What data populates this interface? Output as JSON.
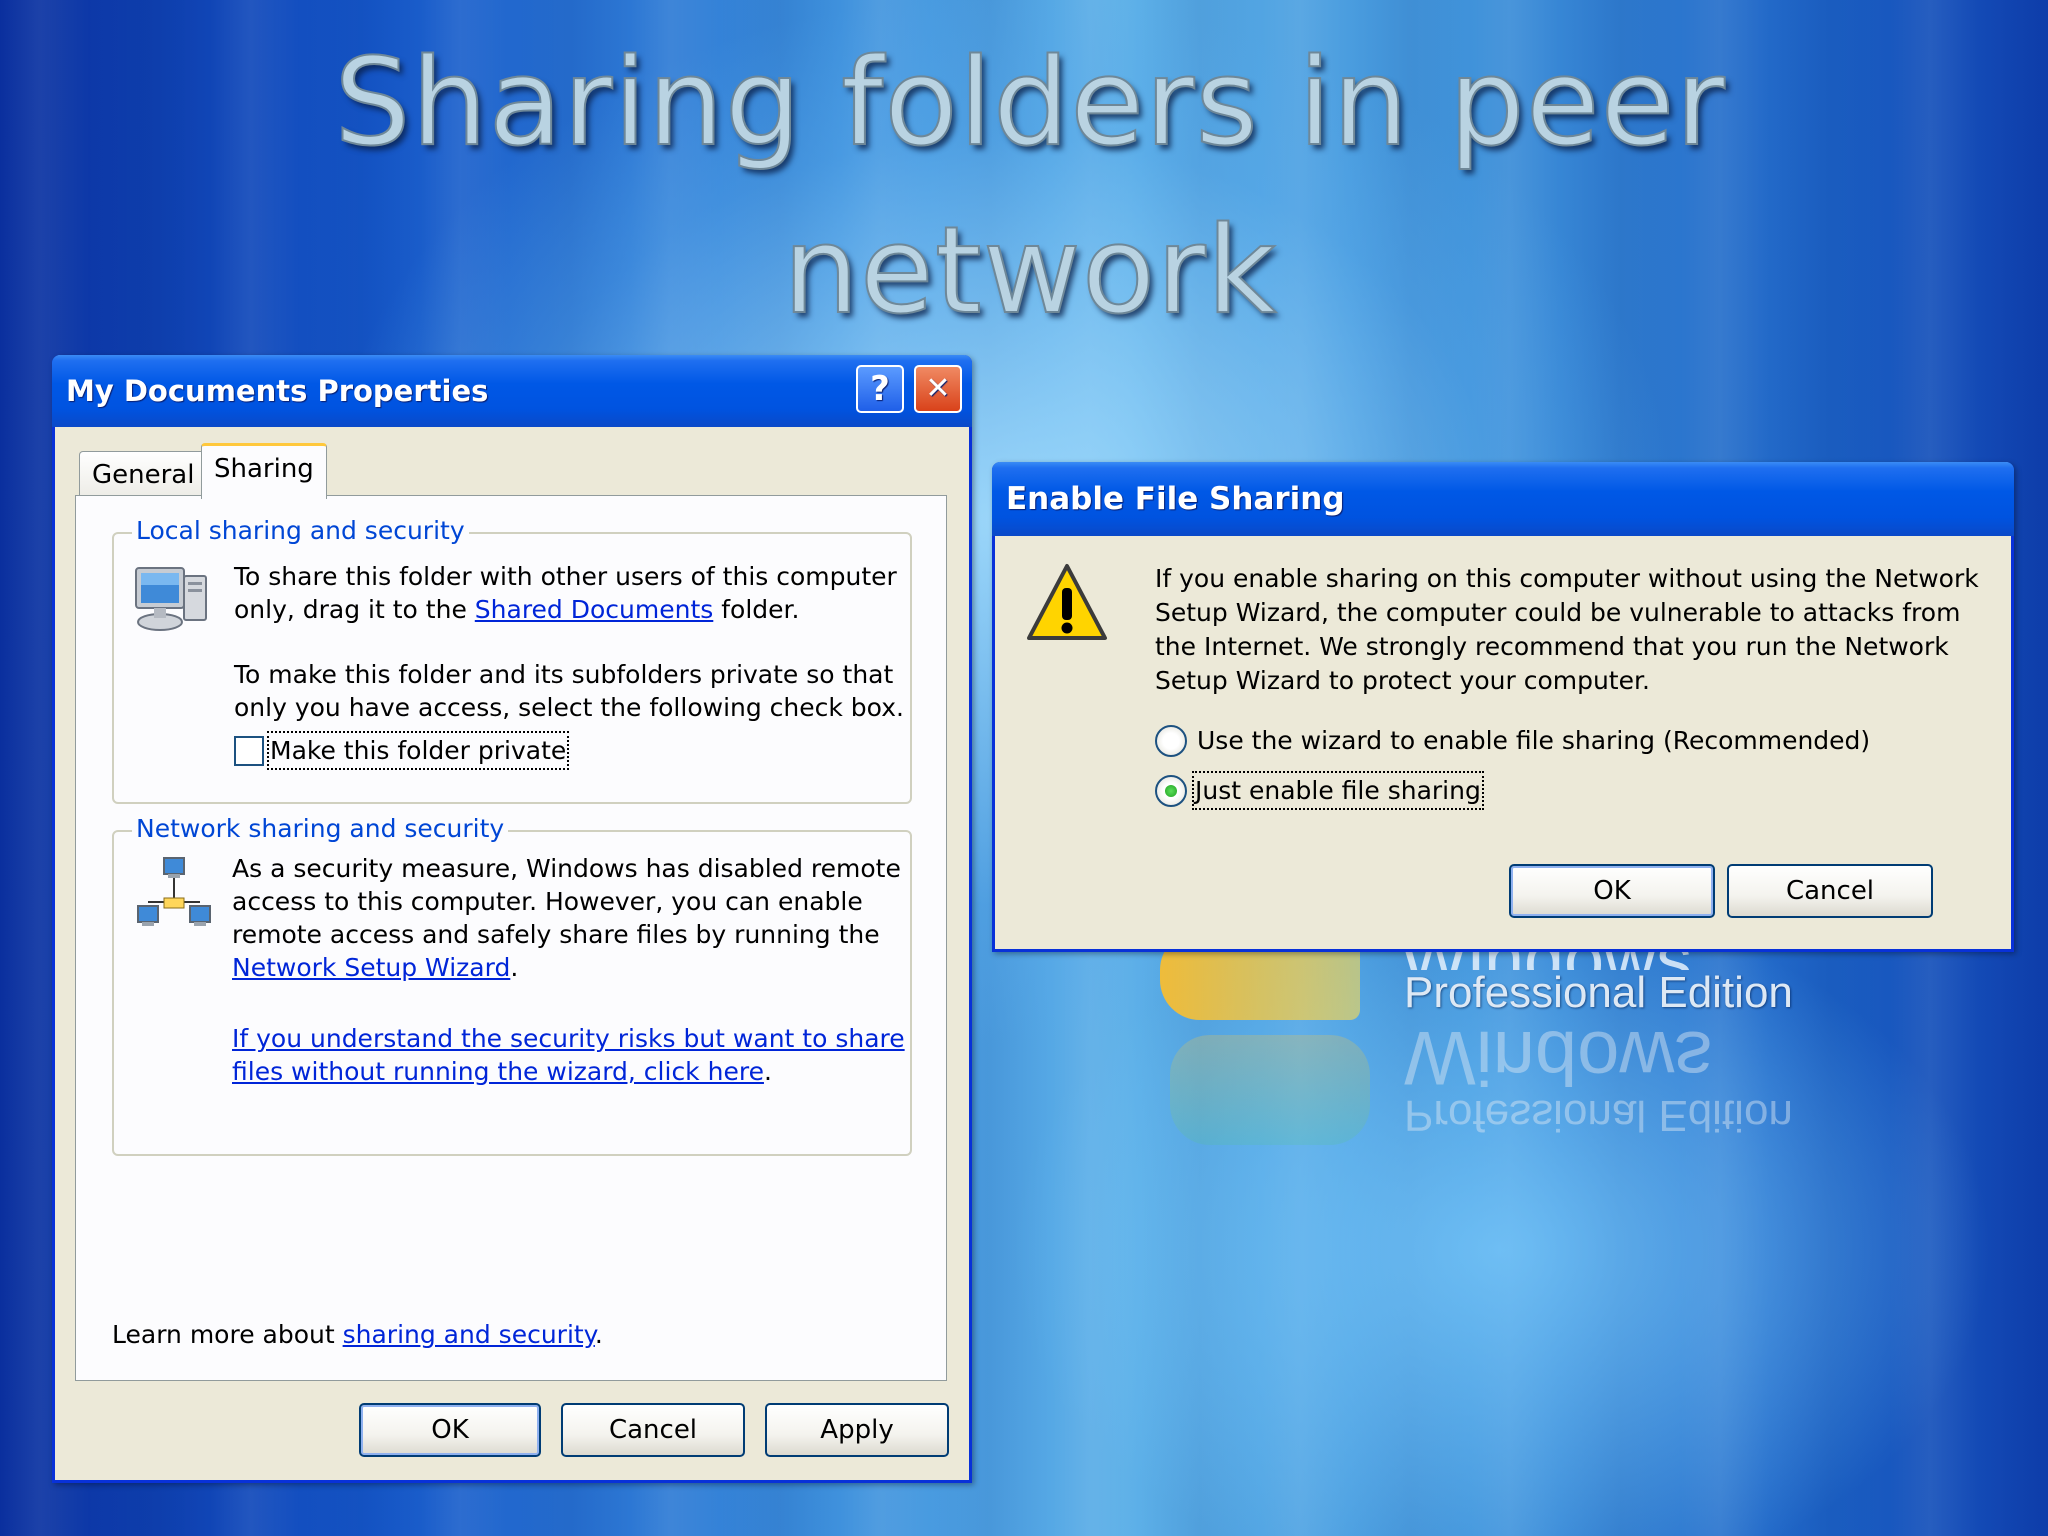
{
  "slide": {
    "title": "Sharing folders in peer network",
    "logo_word": "Windows",
    "logo_edition": "Professional Edition"
  },
  "props_window": {
    "title": "My Documents Properties",
    "help_label": "?",
    "close_label": "✕",
    "tabs": [
      {
        "label": "General",
        "active": false
      },
      {
        "label": "Sharing",
        "active": true
      }
    ],
    "local_group": {
      "legend": "Local sharing and security",
      "line1": "To share this folder with other users of this computer",
      "line2_prefix": "only, drag it to the ",
      "line2_link": "Shared Documents",
      "line2_suffix": " folder.",
      "private_line1": "To make this folder and its subfolders private so that",
      "private_line2": "only you have access, select the following check box.",
      "checkbox_label": "Make this folder private",
      "checkbox_checked": false
    },
    "network_group": {
      "legend": "Network sharing and security",
      "line1": "As a security measure, Windows has disabled remote",
      "line2": "access to this computer. However, you can enable",
      "line3": "remote access and safely share files by running the",
      "wizard_link": "Network Setup Wizard",
      "wizard_suffix": ".",
      "risk_link_line1": "If you understand the security risks but want to share",
      "risk_link_line2": "files without running the wizard, click here",
      "risk_suffix": "."
    },
    "learn_more_prefix": "Learn more about ",
    "learn_more_link": "sharing and security",
    "learn_more_suffix": ".",
    "buttons": {
      "ok": "OK",
      "cancel": "Cancel",
      "apply": "Apply"
    }
  },
  "share_dialog": {
    "title": "Enable File Sharing",
    "message_lines": [
      "If you enable sharing on this computer without using the Network",
      "Setup Wizard, the computer could be vulnerable to attacks from",
      "the Internet. We strongly recommend that you run the Network",
      "Setup Wizard to protect your computer."
    ],
    "options": [
      {
        "label": "Use the wizard to enable file sharing (Recommended)",
        "selected": false
      },
      {
        "label": "Just enable file sharing",
        "selected": true
      }
    ],
    "buttons": {
      "ok": "OK",
      "cancel": "Cancel"
    }
  },
  "colors": {
    "titlebar": "#0058e6",
    "dialog_bg": "#ece9d8",
    "link": "#0025d8",
    "group_label": "#0046d5"
  },
  "icons": {
    "local_group_icon": "computer-icon",
    "network_group_icon": "network-computers-icon",
    "warning": "warning-icon"
  }
}
